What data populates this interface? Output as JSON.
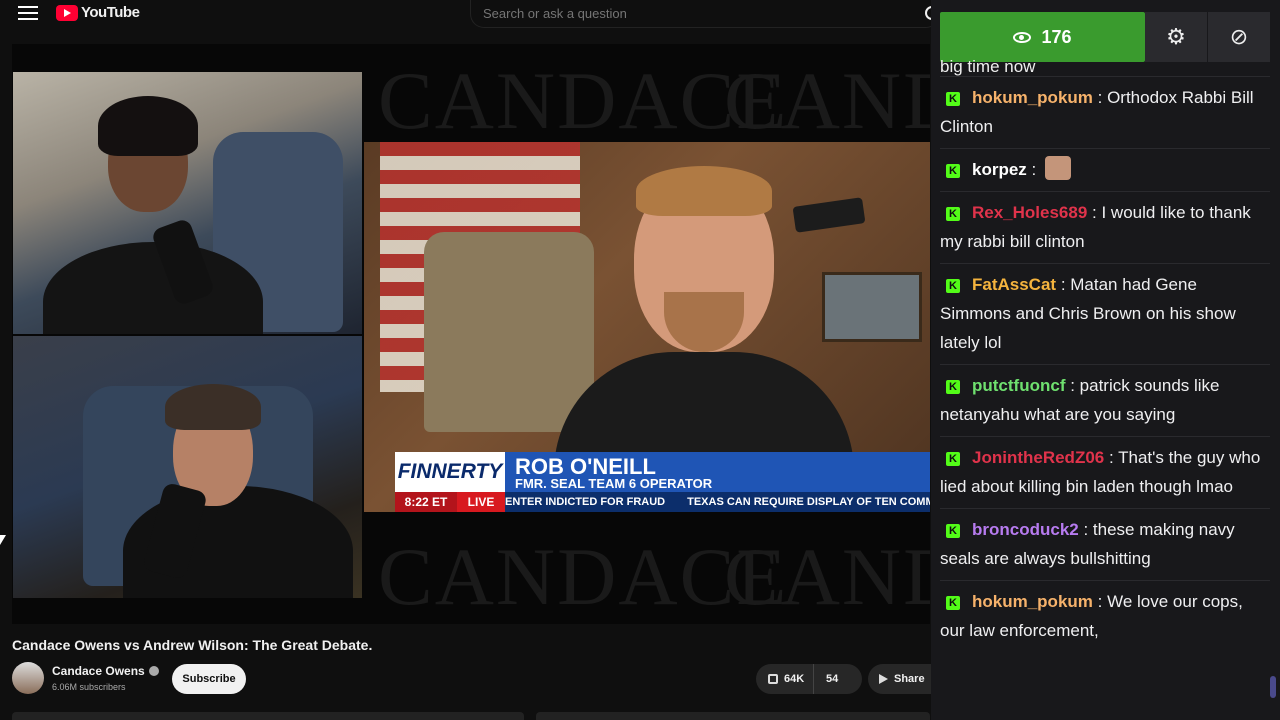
{
  "header": {
    "logo_text": "YouTube",
    "search_placeholder": "Search or ask a question"
  },
  "video": {
    "watermark": "CANDACE",
    "lower_third": {
      "network": "FINNERTY",
      "name": "ROB O'NEILL",
      "title": "FMR. SEAL TEAM 6 OPERATOR",
      "time": "8:22 ET",
      "live": "LIVE",
      "ticker": [
        "ENTER INDICTED FOR FRAUD",
        "TEXAS CAN REQUIRE DISPLAY OF TEN COMMA"
      ]
    }
  },
  "info": {
    "title": "Candace Owens vs Andrew Wilson: The Great Debate.",
    "channel": "Candace Owens",
    "subscribers": "6.06M subscribers",
    "subscribe_label": "Subscribe",
    "likes": "64K",
    "dislikes": "54",
    "share_label": "Share"
  },
  "chat": {
    "viewer_count": "176",
    "partial_top": "big time now",
    "badge": "K",
    "messages": [
      {
        "user": "hokum_pokum",
        "color": "#f6b26b",
        "text": "Orthodox Rabbi Bill Clinton"
      },
      {
        "user": "korpez",
        "color": "#ffffff",
        "text": "",
        "emote": true
      },
      {
        "user": "Rex_Holes689",
        "color": "#e0334b",
        "text": "I would like to thank my rabbi bill clinton"
      },
      {
        "user": "FatAssCat",
        "color": "#f5b43e",
        "text": "Matan had Gene Simmons and Chris Brown on his show lately lol"
      },
      {
        "user": "putctfuoncf",
        "color": "#6fe06f",
        "text": "patrick sounds like netanyahu what are you saying"
      },
      {
        "user": "JonintheRedZ06",
        "color": "#e0334b",
        "text": "That's the guy who lied about killing bin laden though lmao"
      },
      {
        "user": "broncoduck2",
        "color": "#b77bf0",
        "text": "these making navy seals are always bullshitting"
      },
      {
        "user": "hokum_pokum",
        "color": "#f6b26b",
        "text": "We love our cops, our law enforcement,"
      }
    ]
  }
}
